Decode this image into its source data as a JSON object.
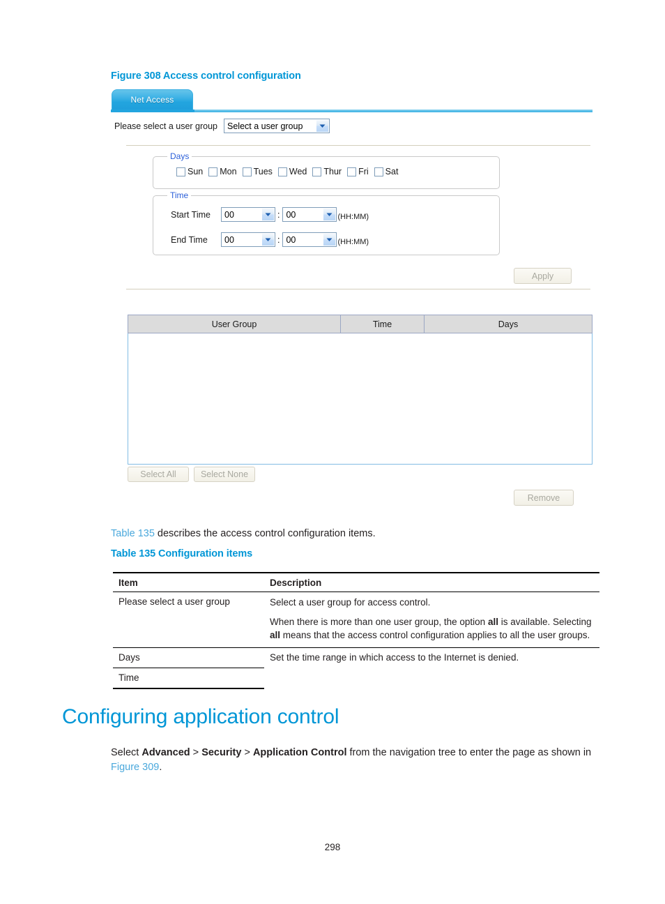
{
  "figure": {
    "caption": "Figure 308 Access control configuration"
  },
  "screenshot": {
    "tab": {
      "label": "Net Access"
    },
    "user_group": {
      "label": "Please select a user group",
      "select_value": "Select a user group"
    },
    "days_fieldset": {
      "legend": "Days",
      "checkboxes": [
        {
          "label": "Sun",
          "checked": false
        },
        {
          "label": "Mon",
          "checked": false
        },
        {
          "label": "Tues",
          "checked": false
        },
        {
          "label": "Wed",
          "checked": false
        },
        {
          "label": "Thur",
          "checked": false
        },
        {
          "label": "Fri",
          "checked": false
        },
        {
          "label": "Sat",
          "checked": false
        }
      ]
    },
    "time_fieldset": {
      "legend": "Time",
      "start": {
        "label": "Start Time",
        "hour": "00",
        "minute": "00",
        "format_hint": "(HH:MM)"
      },
      "end": {
        "label": "End Time",
        "hour": "00",
        "minute": "00",
        "format_hint": "(HH:MM)"
      },
      "separator": ":"
    },
    "buttons": {
      "apply": "Apply",
      "select_all": "Select All",
      "select_none": "Select None",
      "remove": "Remove"
    },
    "table": {
      "columns": [
        "User Group",
        "Time",
        "Days"
      ],
      "rows": []
    },
    "colors": {
      "tab_blue": "#23a5df",
      "legend_blue": "#2b5fd9",
      "table_header_gray": "#dcdcdc",
      "table_border_blue": "#82bce4",
      "disabled_button_text": "#a9a9a0"
    }
  },
  "body": {
    "table_intro": {
      "link": "Table 135",
      "rest": " describes the access control configuration items."
    },
    "table_caption": "Table 135 Configuration items",
    "doc_table": {
      "headers": [
        "Item",
        "Description"
      ],
      "rows": [
        {
          "item": "Please select a user group",
          "desc_line1": "Select a user group for access control.",
          "desc_line2_a": "When there is more than one user group, the option ",
          "desc_line2_b": "all",
          "desc_line2_c": " is available. Selecting ",
          "desc_line2_d": "all",
          "desc_line2_e": " means that the access control configuration applies to all the user groups."
        },
        {
          "item": "Days",
          "desc": "Set the time range in which access to the Internet is denied."
        },
        {
          "item": "Time",
          "desc": ""
        }
      ]
    },
    "heading": "Configuring application control",
    "select_paragraph": {
      "prefix": "Select ",
      "nav1": "Advanced",
      "sep1": " > ",
      "nav2": "Security",
      "sep2": " > ",
      "nav3": "Application Control",
      "middle": " from the navigation tree to enter the page as shown in ",
      "link": "Figure 309",
      "suffix": "."
    }
  },
  "page": {
    "number": "298"
  }
}
